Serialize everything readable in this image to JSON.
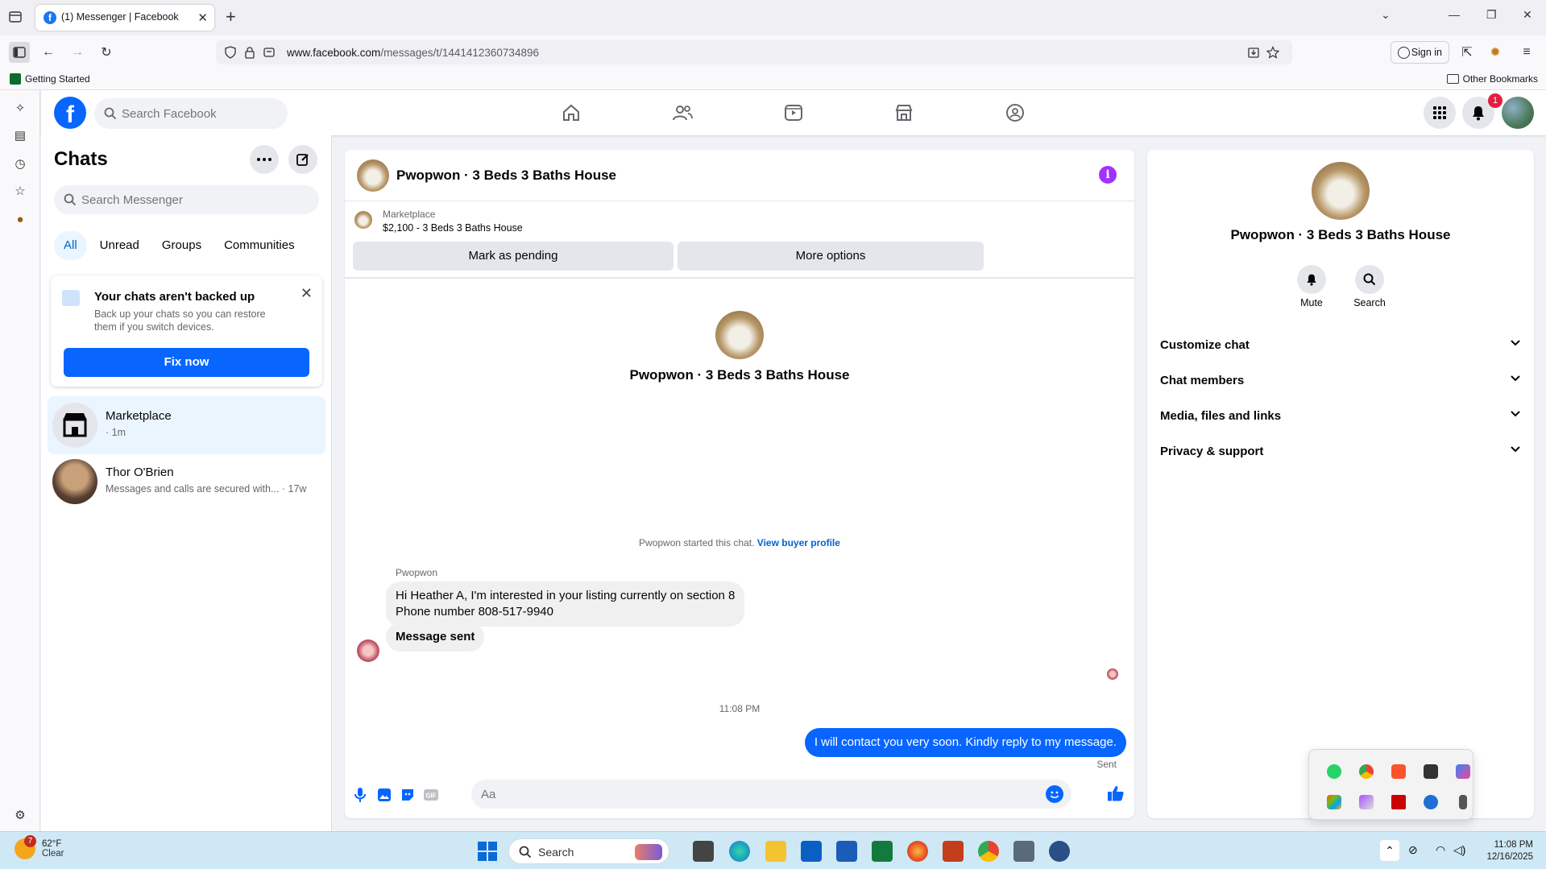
{
  "browser": {
    "tab_title": "(1) Messenger | Facebook",
    "url_domain": "www.facebook.com",
    "url_path": "/messages/t/1441412360734896",
    "sign_in": "Sign in",
    "bookmark_left": "Getting Started",
    "bookmark_right": "Other Bookmarks"
  },
  "facebook": {
    "search_placeholder": "Search Facebook",
    "notification_count": "1"
  },
  "chats": {
    "title": "Chats",
    "search_placeholder": "Search Messenger",
    "filters": [
      "All",
      "Unread",
      "Groups",
      "Communities"
    ],
    "backup_title": "Your chats aren't backed up",
    "backup_body": "Back up your chats so you can restore them if you switch devices.",
    "backup_button": "Fix now",
    "list": [
      {
        "name": "Marketplace",
        "sub": "· 1m"
      },
      {
        "name": "Thor O'Brien",
        "sub": "Messages and calls are secured with... · 17w"
      }
    ]
  },
  "conversation": {
    "title": "Pwopwon · 3 Beds 3 Baths House",
    "marketplace_label": "Marketplace",
    "listing": "$2,100 - 3 Beds 3 Baths House",
    "mark_pending": "Mark as pending",
    "more_options": "More options",
    "center_name": "Pwopwon · 3 Beds 3 Baths House",
    "started_text": "Pwopwon started this chat.",
    "buyer_link": "View buyer profile",
    "sender": "Pwopwon",
    "msg1_line1": "Hi Heather A, I'm interested in your listing currently on section 8",
    "msg1_line2": "Phone number 808-517-9940",
    "msg2": "Message sent",
    "time": "11:08 PM",
    "outgoing": "I will contact you very soon. Kindly reply to my message.",
    "sent_label": "Sent",
    "composer_placeholder": "Aa"
  },
  "details": {
    "name": "Pwopwon · 3 Beds 3 Baths House",
    "actions": [
      "Mute",
      "Search"
    ],
    "sections": [
      "Customize chat",
      "Chat members",
      "Media, files and links",
      "Privacy & support"
    ]
  },
  "taskbar": {
    "weather_temp": "62°F",
    "weather_cond": "Clear",
    "weather_badge": "7",
    "search": "Search",
    "time": "11:08 PM",
    "date": "12/16/2025"
  }
}
